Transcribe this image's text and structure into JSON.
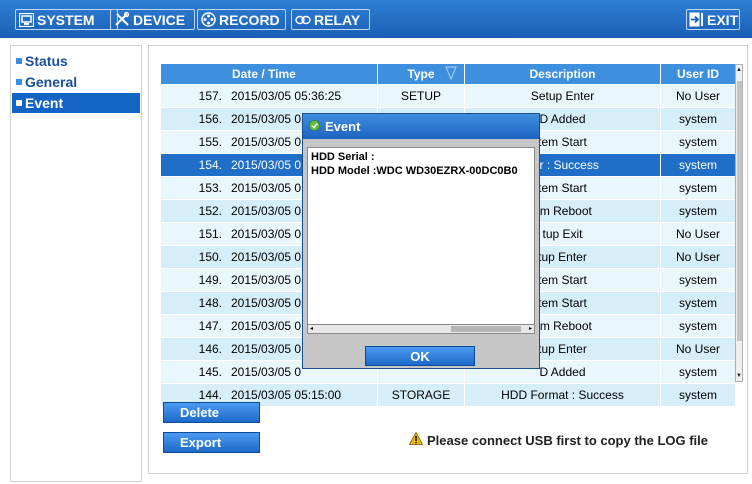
{
  "topbar": {
    "tabs": [
      {
        "label": "SYSTEM",
        "icon": "monitor-icon"
      },
      {
        "label": "DEVICE",
        "icon": "tools-icon"
      },
      {
        "label": "RECORD",
        "icon": "film-reel-icon"
      },
      {
        "label": "RELAY",
        "icon": "relay-icon"
      }
    ],
    "exit_label": "EXIT"
  },
  "sidebar": {
    "items": [
      {
        "label": "Status",
        "active": false
      },
      {
        "label": "General",
        "active": false
      },
      {
        "label": "Event",
        "active": true
      }
    ]
  },
  "table": {
    "headers": [
      "Date / Time",
      "Type",
      "Description",
      "User ID"
    ],
    "rows": [
      {
        "no": "157.",
        "datetime": "2015/03/05 05:36:25",
        "type": "SETUP",
        "desc": "Setup Enter",
        "user": "No User"
      },
      {
        "no": "156.",
        "datetime": "2015/03/05 0",
        "type": "",
        "desc": "D Added",
        "user": "system"
      },
      {
        "no": "155.",
        "datetime": "2015/03/05 0",
        "type": "",
        "desc": "tem Start",
        "user": "system"
      },
      {
        "no": "154.",
        "datetime": "2015/03/05 0",
        "type": "",
        "desc": "ear : Success",
        "user": "system",
        "selected": true
      },
      {
        "no": "153.",
        "datetime": "2015/03/05 0",
        "type": "",
        "desc": "tem Start",
        "user": "system"
      },
      {
        "no": "152.",
        "datetime": "2015/03/05 0",
        "type": "",
        "desc": "em Reboot",
        "user": "system"
      },
      {
        "no": "151.",
        "datetime": "2015/03/05 0",
        "type": "",
        "desc": "tup Exit",
        "user": "No User"
      },
      {
        "no": "150.",
        "datetime": "2015/03/05 0",
        "type": "",
        "desc": "tup Enter",
        "user": "No User"
      },
      {
        "no": "149.",
        "datetime": "2015/03/05 0",
        "type": "",
        "desc": "tem Start",
        "user": "system"
      },
      {
        "no": "148.",
        "datetime": "2015/03/05 0",
        "type": "",
        "desc": "tem Start",
        "user": "system"
      },
      {
        "no": "147.",
        "datetime": "2015/03/05 0",
        "type": "",
        "desc": "em Reboot",
        "user": "system"
      },
      {
        "no": "146.",
        "datetime": "2015/03/05 0",
        "type": "",
        "desc": "tup Enter",
        "user": "No User"
      },
      {
        "no": "145.",
        "datetime": "2015/03/05 0",
        "type": "",
        "desc": "D Added",
        "user": "system"
      },
      {
        "no": "144.",
        "datetime": "2015/03/05 05:15:00",
        "type": "STORAGE",
        "desc": "HDD Format : Success",
        "user": "system"
      }
    ]
  },
  "buttons": {
    "delete_label": "Delete",
    "export_label": "Export"
  },
  "notice": "Please connect USB first to copy the LOG file",
  "dialog": {
    "title": "Event",
    "lines": [
      "HDD Serial :",
      "HDD Model :WDC WD30EZRX-00DC0B0"
    ],
    "ok_label": "OK"
  },
  "colors": {
    "accent": "#1364c5",
    "header": "#3e90de",
    "row_light": "#e9f6fc",
    "row_dark": "#d6eef9",
    "selected": "#1f6fc9"
  }
}
